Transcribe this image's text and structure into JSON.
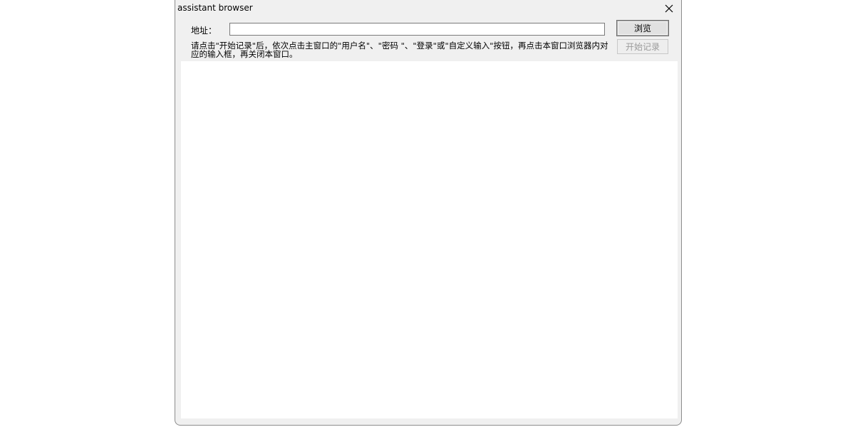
{
  "window": {
    "title": "assistant browser"
  },
  "address": {
    "label": "地址：",
    "value": "",
    "placeholder": ""
  },
  "buttons": {
    "browse_label": "浏览",
    "start_record_label": "开始记录"
  },
  "instructions": {
    "text": "请点击\"开始记录\"后，依次点击主窗口的\"用户名\"、\"密码 \"、\"登录\"或\"自定义输入\"按钮，再点击本窗口浏览器内对应的输入框，再关闭本窗口。"
  },
  "icons": {
    "close": "close-icon"
  },
  "colors": {
    "window_bg": "#f0f0f0",
    "view_bg": "#ffffff",
    "disabled_text": "#9a9a9a"
  }
}
